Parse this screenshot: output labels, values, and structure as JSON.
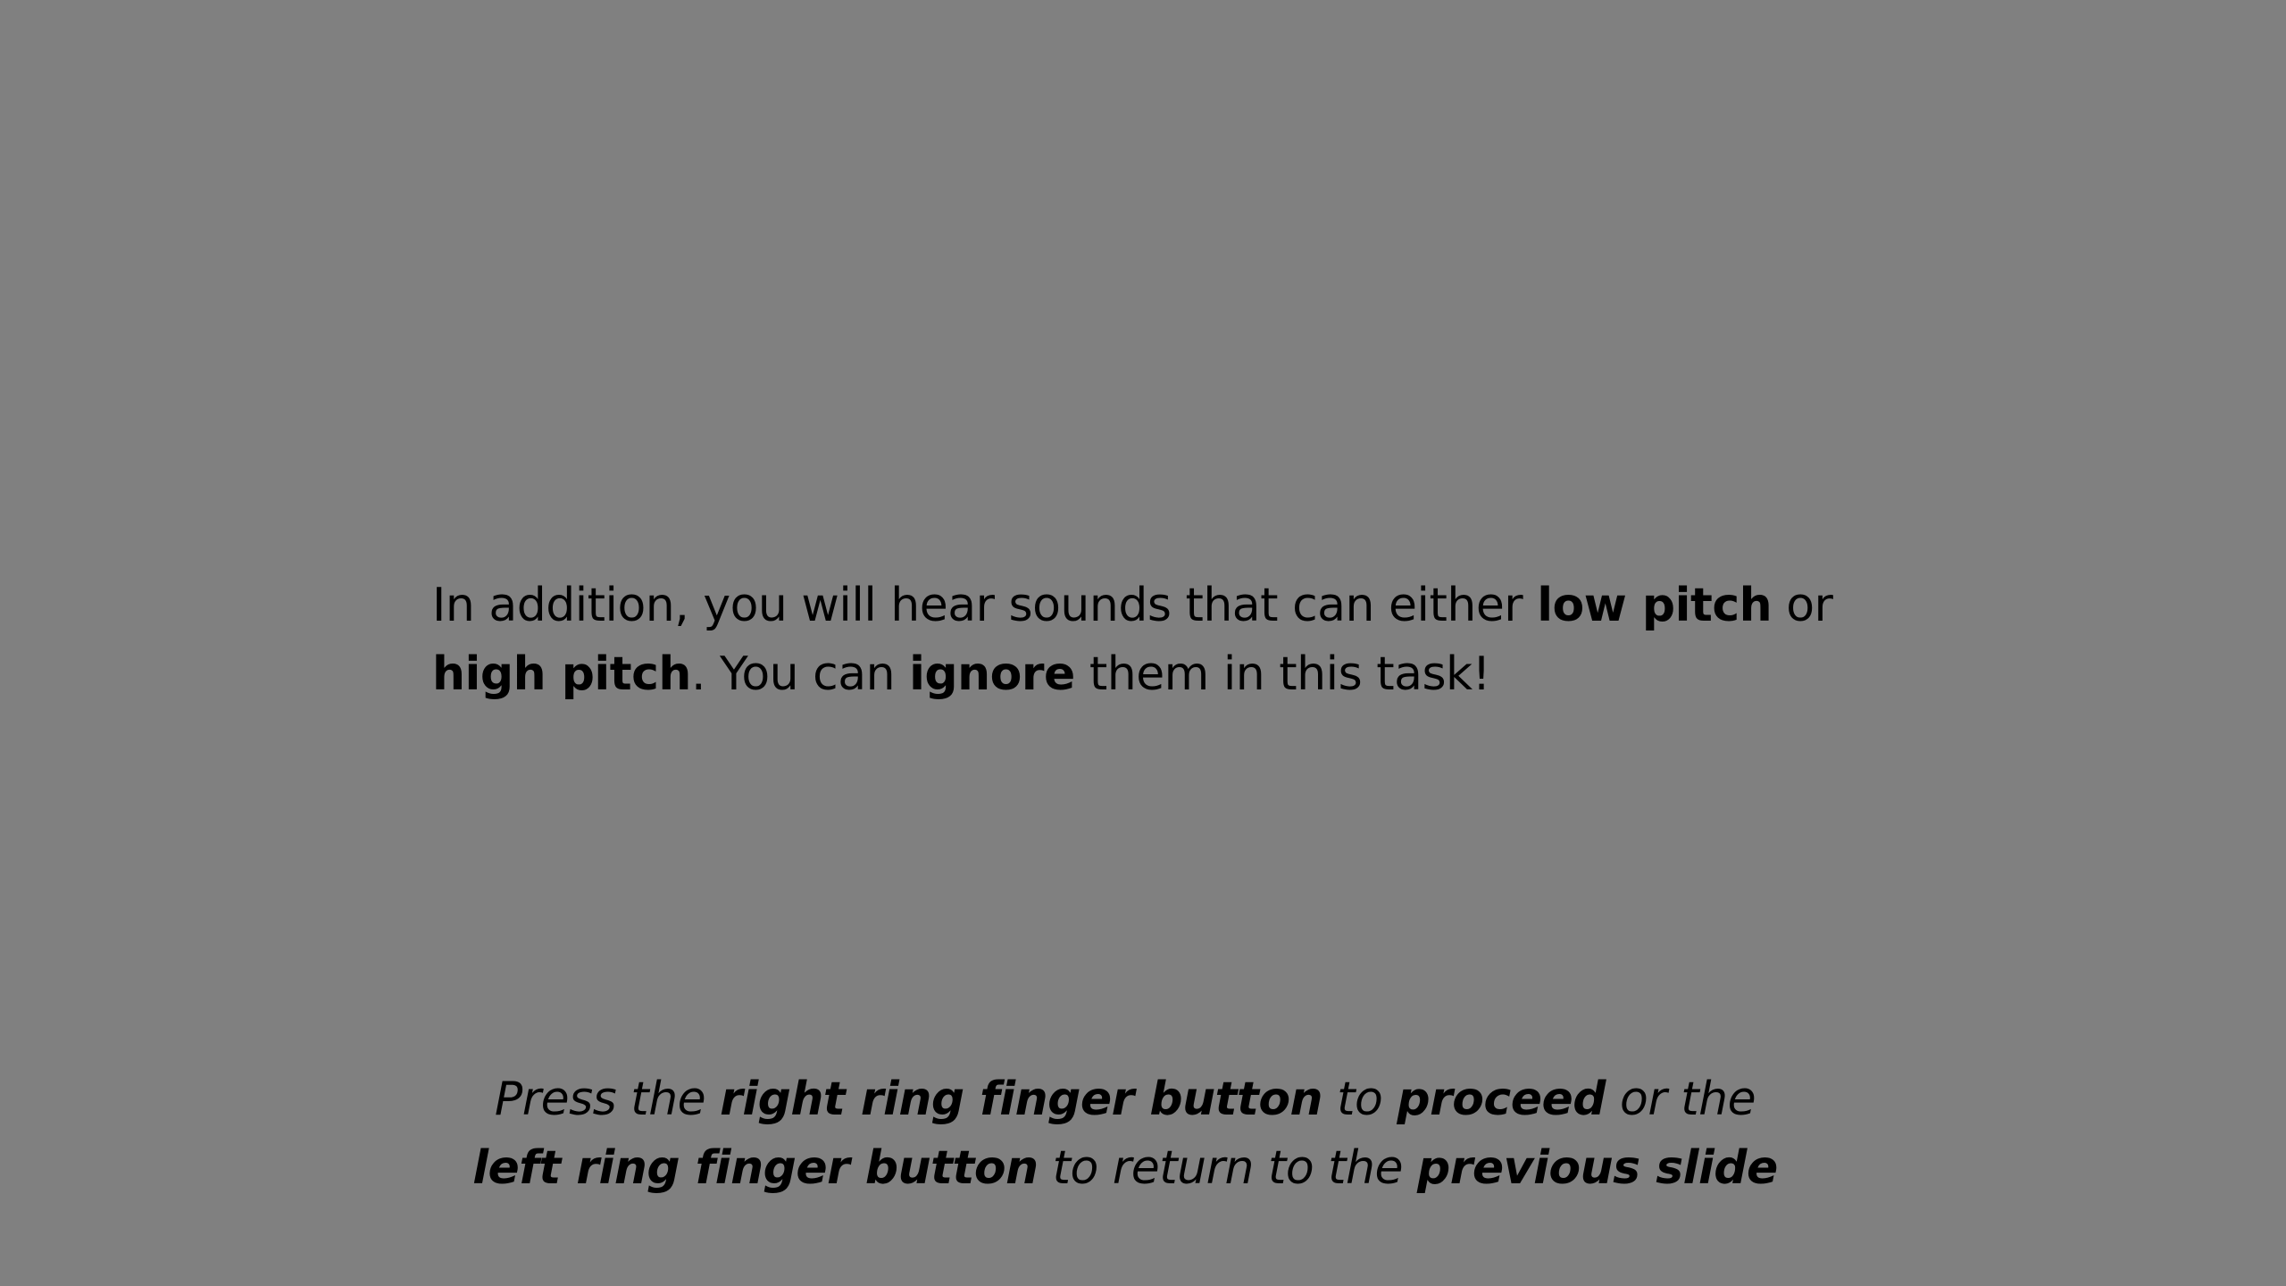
{
  "instruction": {
    "line1": {
      "t1": "In addition, you will hear sounds that can either ",
      "b1": "low pitch",
      "t2": " or"
    },
    "line2": {
      "b1": "high pitch",
      "t1": ". You can ",
      "b2": "ignore",
      "t2": " them in this task!"
    }
  },
  "navigation_hint": {
    "line1": {
      "t1": "Press the ",
      "b1": "right ring finger button",
      "t2": " to ",
      "b2": "proceed",
      "t3": " or the"
    },
    "line2": {
      "b1": "left ring finger button",
      "t1": " to return to the ",
      "b2": "previous slide"
    }
  },
  "colors": {
    "background": "#808080",
    "text": "#000000"
  }
}
